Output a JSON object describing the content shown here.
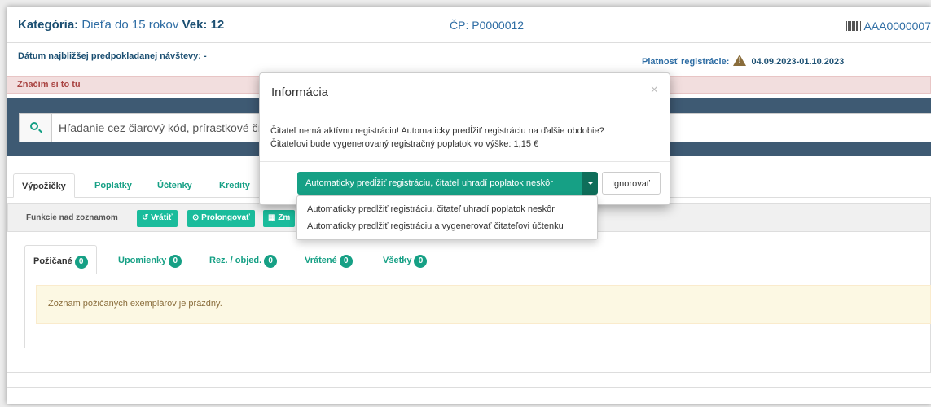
{
  "header": {
    "category_label": "Kategória:",
    "category_value": "Dieťa do 15 rokov",
    "age_label": "Vek:",
    "age_value": "12",
    "cp": "ČP: P0000012",
    "barcode": "AAA0000007",
    "next_visit": "Dátum najbližšej predpokladanej návštevy: -",
    "registration_label": "Platnosť registrácie:",
    "registration_dates": "04.09.2023-01.10.2023"
  },
  "note": "Značím si to tu",
  "search": {
    "placeholder": "Hľadanie cez čiarový kód, prírastkové číslo..."
  },
  "main_tabs": [
    {
      "label": "Výpožičky"
    },
    {
      "label": "Poplatky"
    },
    {
      "label": "Účtenky"
    },
    {
      "label": "Kredity"
    }
  ],
  "toolbar": {
    "label": "Funkcie nad zoznamom",
    "return_label": "Vrátiť",
    "prolong_label": "Prolongovať",
    "change_label": "Zm"
  },
  "sub_tabs": [
    {
      "label": "Požičané",
      "count": "0"
    },
    {
      "label": "Upomienky",
      "count": "0"
    },
    {
      "label": "Rez. / objed.",
      "count": "0"
    },
    {
      "label": "Vrátené",
      "count": "0"
    },
    {
      "label": "Všetky",
      "count": "0"
    }
  ],
  "empty_message": "Zoznam požičaných exemplárov je prázdny.",
  "modal": {
    "title": "Informácia",
    "close": "×",
    "message_line1": "Čitateľ nemá aktívnu registráciu! Automaticky predĺžiť registráciu na ďalšie obdobie?",
    "message_line2": "Čitateľovi bude vygenerovaný registračný poplatok vo výške: 1,15 €",
    "primary_button": "Automaticky predĺžiť registráciu, čitateľ uhradí poplatok neskôr",
    "ignore_button": "Ignorovať",
    "dropdown_items": [
      "Automaticky predĺžiť registráciu, čitateľ uhradí poplatok neskôr",
      "Automaticky predĺžiť registráciu a vygenerovať čitateľovi účtenku"
    ]
  }
}
